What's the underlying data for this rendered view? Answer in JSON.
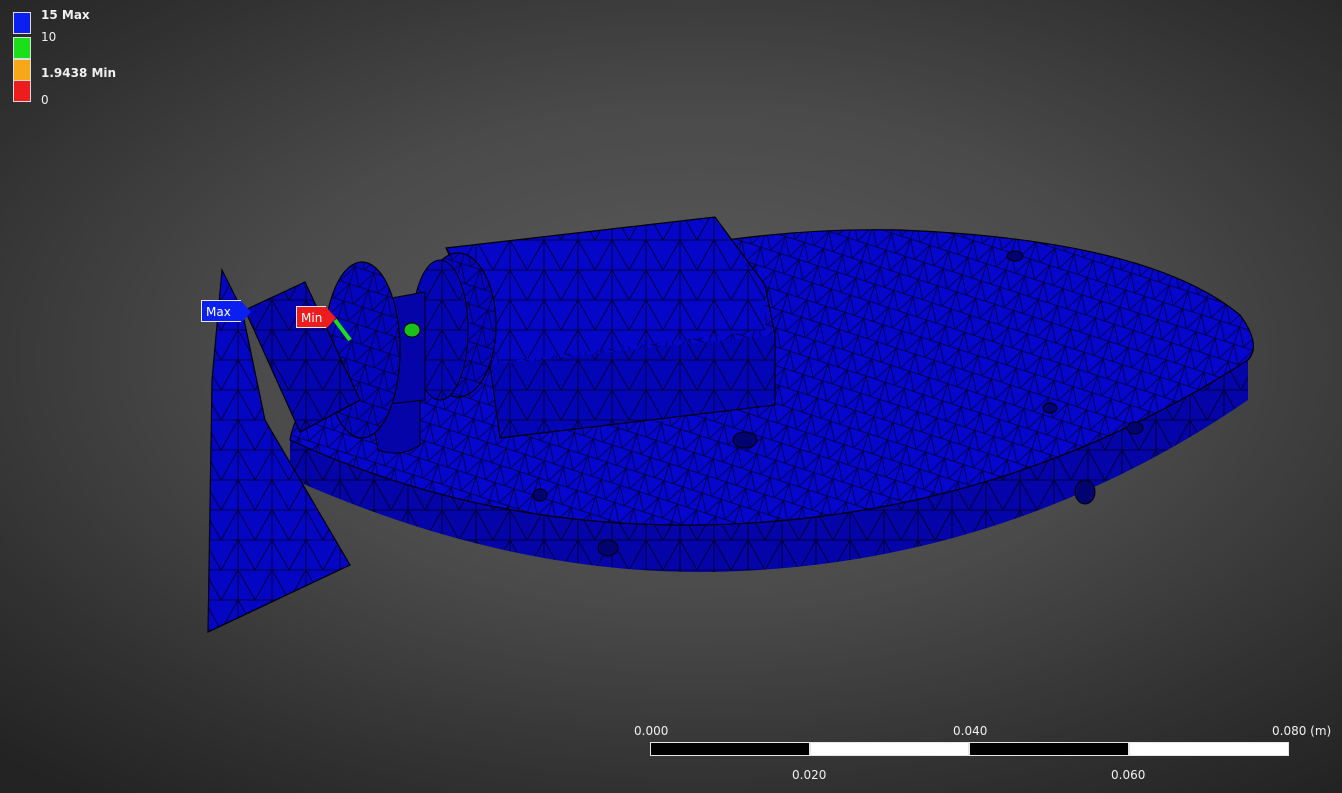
{
  "legend": {
    "items": [
      {
        "label": "15 Max",
        "color": "#0b1ff0",
        "bold": true
      },
      {
        "label": "10",
        "color": "#19e019",
        "bold": false
      },
      {
        "label": "1.9438 Min",
        "color": "#f5a818",
        "bold": true
      },
      {
        "label": "0",
        "color": "#ee1c1c",
        "bold": false
      }
    ]
  },
  "probes": {
    "max_label": "Max",
    "min_label": "Min"
  },
  "scale": {
    "top_labels": [
      "0.000",
      "0.040",
      "0.080 (m)"
    ],
    "bottom_labels": [
      "0.020",
      "0.060"
    ]
  },
  "model": {
    "mesh_color": "#0505c8",
    "shade_color": "#0303a0",
    "edge_color": "#000000"
  }
}
